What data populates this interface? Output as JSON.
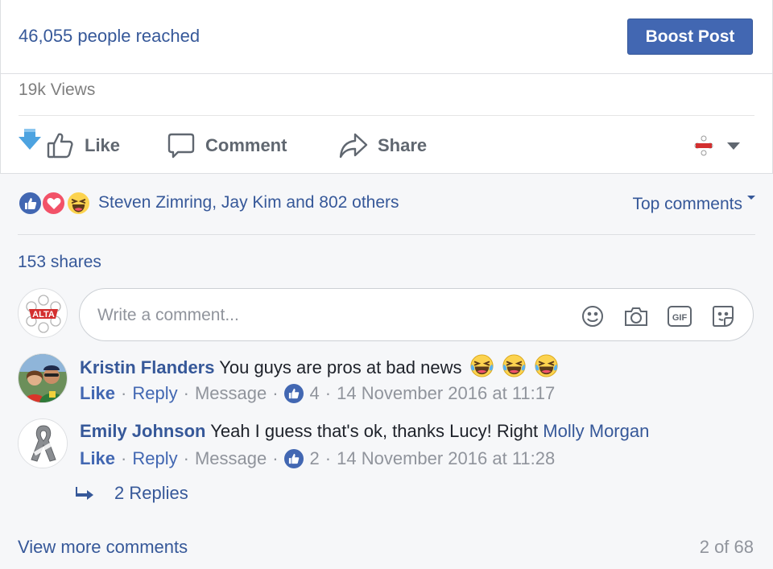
{
  "stats": {
    "reach": "46,055 people reached",
    "boost_label": "Boost Post",
    "views": "19k Views"
  },
  "actions": {
    "like": "Like",
    "comment": "Comment",
    "share": "Share"
  },
  "reactions": {
    "icons": [
      "like-reaction-icon",
      "love-reaction-icon",
      "haha-reaction-icon"
    ],
    "summary": "Steven Zimring, Jay Kim and 802 others",
    "sort_label": "Top comments"
  },
  "shares": "153 shares",
  "composer": {
    "avatar_text": "ALTA",
    "placeholder": "Write a comment..."
  },
  "comments": [
    {
      "author": "Kristin Flanders",
      "text": "You guys are pros at bad news",
      "emojis": 3,
      "like": "Like",
      "reply": "Reply",
      "message": "Message",
      "likes": "4",
      "timestamp": "14 November 2016 at 11:17"
    },
    {
      "author": "Emily Johnson",
      "text": "Yeah I guess that's ok, thanks Lucy! Right",
      "mention": "Molly Morgan",
      "like": "Like",
      "reply": "Reply",
      "message": "Message",
      "likes": "2",
      "timestamp": "14 November 2016 at 11:28"
    }
  ],
  "replies_label": "2 Replies",
  "footer": {
    "view_more": "View more comments",
    "count": "2 of 68"
  },
  "colors": {
    "link": "#365899",
    "button": "#4267b2",
    "muted": "#90949c",
    "love": "#f25268",
    "haha": "#fcd34f"
  }
}
